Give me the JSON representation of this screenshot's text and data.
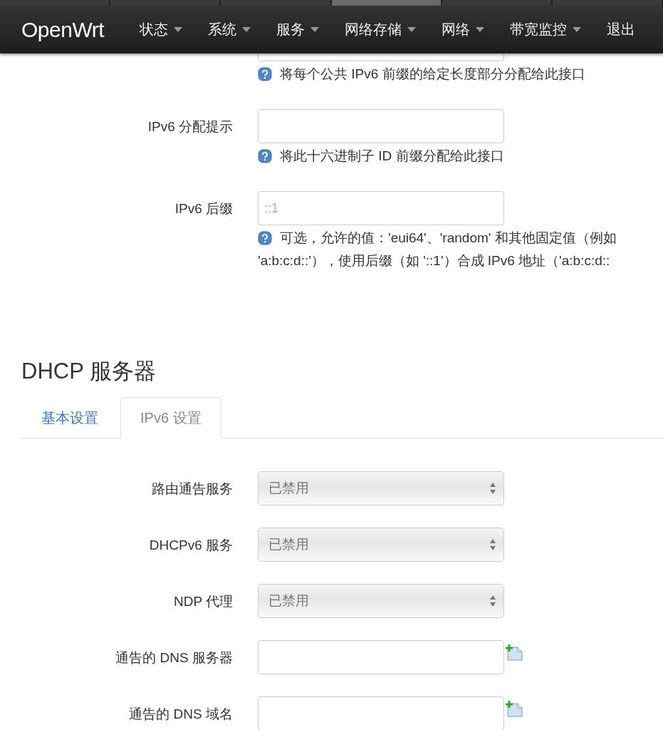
{
  "navbar": {
    "brand": "OpenWrt",
    "menu": [
      {
        "label": "状态",
        "dropdown": true
      },
      {
        "label": "系统",
        "dropdown": true
      },
      {
        "label": "服务",
        "dropdown": true
      },
      {
        "label": "网络存储",
        "dropdown": true
      },
      {
        "label": "网络",
        "dropdown": true
      },
      {
        "label": "带宽监控",
        "dropdown": true
      },
      {
        "label": "退出",
        "dropdown": false
      }
    ]
  },
  "interface_fields": [
    {
      "kind": "cut",
      "help_lines": [
        "将每个公共 IPv6 前缀的给定长度部分分配给此接口"
      ]
    },
    {
      "kind": "input",
      "label": "IPv6 分配提示",
      "help_lines": [
        "将此十六进制子 ID 前缀分配给此接口"
      ]
    },
    {
      "kind": "input",
      "label": "IPv6 后缀",
      "placeholder": "::1",
      "help_lines": [
        "可选，允许的值：'eui64'、'random' 和其他固定值（例如",
        "'a:b:c:d::'），使用后缀（如 '::1'）合成 IPv6 地址（'a:b:c:d::"
      ]
    }
  ],
  "dhcp_server": {
    "title": "DHCP 服务器",
    "tabs": [
      {
        "label": "基本设置",
        "selected": false
      },
      {
        "label": "IPv6 设置",
        "selected": true
      }
    ],
    "fields": [
      {
        "kind": "select",
        "label": "路由通告服务",
        "value": "已禁用"
      },
      {
        "kind": "select",
        "label": "DHCPv6 服务",
        "value": "已禁用"
      },
      {
        "kind": "select",
        "label": "NDP 代理",
        "value": "已禁用"
      },
      {
        "kind": "list",
        "label": "通告的 DNS 服务器"
      },
      {
        "kind": "list",
        "label": "通告的 DNS 域名"
      }
    ]
  }
}
